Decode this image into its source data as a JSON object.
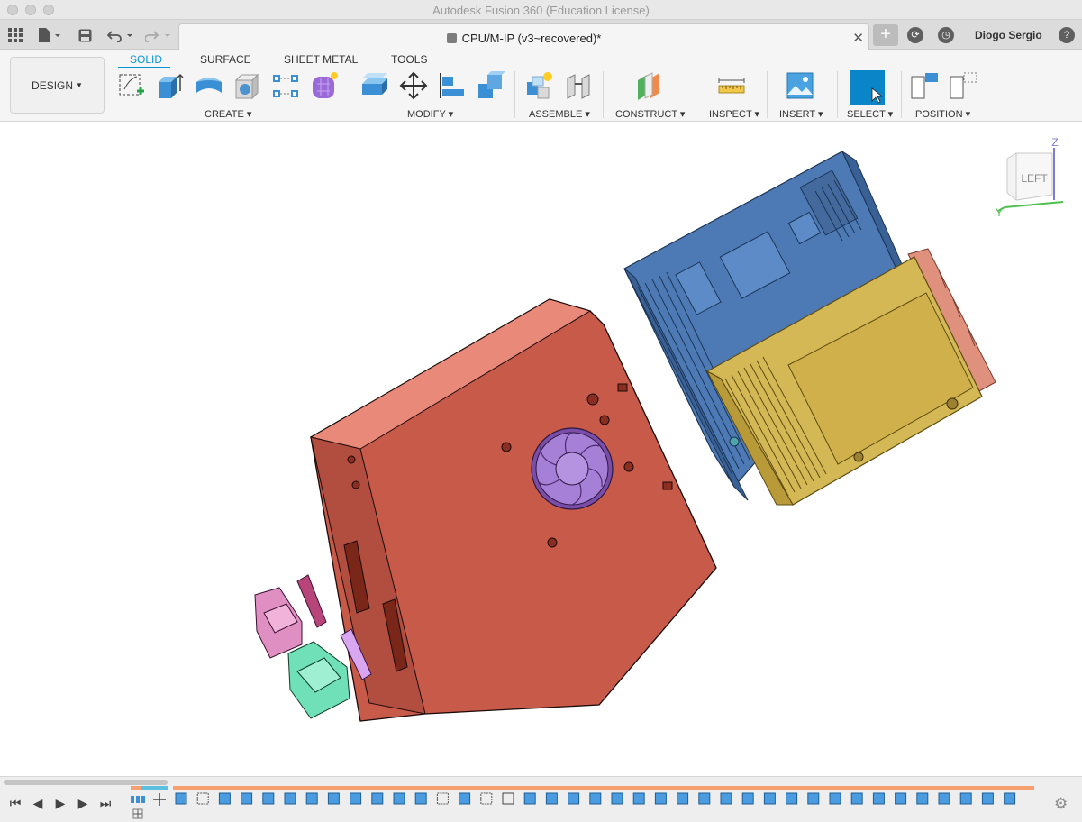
{
  "window": {
    "title": "Autodesk Fusion 360 (Education License)"
  },
  "tabbar": {
    "doc_title": "CPU/M-IP (v3~recovered)*",
    "user_name": "Diogo Sergio"
  },
  "toolbar": {
    "workspace": "DESIGN",
    "tabs": [
      "SOLID",
      "SURFACE",
      "SHEET METAL",
      "TOOLS"
    ],
    "active_tab": "SOLID",
    "groups": [
      "CREATE",
      "MODIFY",
      "ASSEMBLE",
      "CONSTRUCT",
      "INSPECT",
      "INSERT",
      "SELECT",
      "POSITION"
    ]
  },
  "viewcube": {
    "face_label": "LEFT",
    "axis_z": "Z",
    "axis_y": "Y"
  },
  "colors": {
    "accent": "#0696d7",
    "case_red": "#c85a4a",
    "board_blue": "#4d7ab5",
    "board_yellow": "#d4b855",
    "fan_purple": "#a67fd6",
    "part_pink": "#e08fc3",
    "part_green": "#6fe0b8",
    "timeline_orange": "#f5a06e"
  }
}
